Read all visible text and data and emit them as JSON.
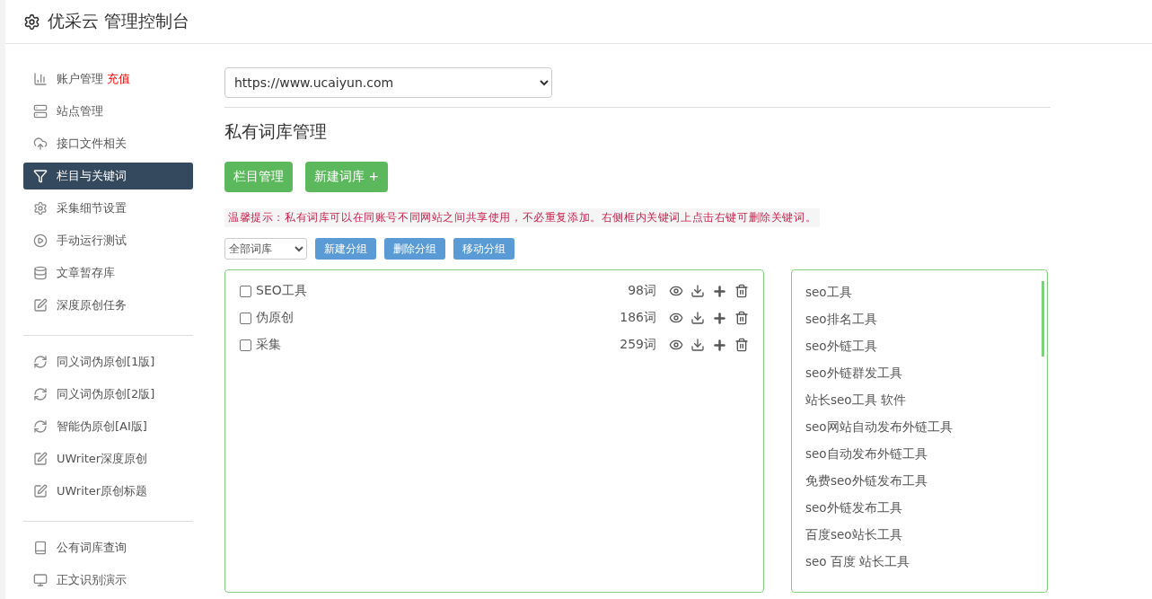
{
  "header": {
    "title": "优采云 管理控制台"
  },
  "sidebar": {
    "groups": [
      {
        "items": [
          {
            "kind": "chart",
            "label": "账户管理",
            "badge": "充值",
            "selected": false
          },
          {
            "kind": "server",
            "label": "站点管理",
            "selected": false
          },
          {
            "kind": "cloud",
            "label": "接口文件相关",
            "selected": false
          },
          {
            "kind": "filter",
            "label": "栏目与关键词",
            "selected": true
          },
          {
            "kind": "gears",
            "label": "采集细节设置",
            "selected": false
          },
          {
            "kind": "play",
            "label": "手动运行测试",
            "selected": false
          },
          {
            "kind": "database",
            "label": "文章暂存库",
            "selected": false
          },
          {
            "kind": "edit",
            "label": "深度原创任务",
            "selected": false
          }
        ]
      },
      {
        "items": [
          {
            "kind": "refresh",
            "label": "同义词伪原创[1版]",
            "selected": false
          },
          {
            "kind": "refresh",
            "label": "同义词伪原创[2版]",
            "selected": false
          },
          {
            "kind": "refresh",
            "label": "智能伪原创[AI版]",
            "selected": false
          },
          {
            "kind": "edit",
            "label": "UWriter深度原创",
            "selected": false
          },
          {
            "kind": "edit",
            "label": "UWriter原创标题",
            "selected": false
          }
        ]
      },
      {
        "items": [
          {
            "kind": "book",
            "label": "公有词库查询",
            "selected": false
          },
          {
            "kind": "monitor",
            "label": "正文识别演示",
            "selected": false
          }
        ]
      }
    ]
  },
  "site_select": {
    "value": "https://www.ucaiyun.com"
  },
  "section_title": "私有词库管理",
  "top_buttons": [
    "栏目管理",
    "新建词库 +"
  ],
  "tip": "温馨提示：私有词库可以在同账号不同网站之间共享使用，不必重复添加。右侧框内关键词上点击右键可删除关键词。",
  "filter_select": {
    "value": "全部词库"
  },
  "group_buttons": [
    "新建分组",
    "删除分组",
    "移动分组"
  ],
  "libraries": [
    {
      "name": "SEO工具",
      "count": "98词",
      "checked": false
    },
    {
      "name": "伪原创",
      "count": "186词",
      "checked": false
    },
    {
      "name": "采集",
      "count": "259词",
      "checked": false
    }
  ],
  "keywords": [
    "seo工具",
    "seo排名工具",
    "seo外链工具",
    "seo外链群发工具",
    "站长seo工具 软件",
    "seo网站自动发布外链工具",
    "seo自动发布外链工具",
    "免费seo外链发布工具",
    "seo外链发布工具",
    "百度seo站长工具",
    "seo 百度 站长工具"
  ]
}
